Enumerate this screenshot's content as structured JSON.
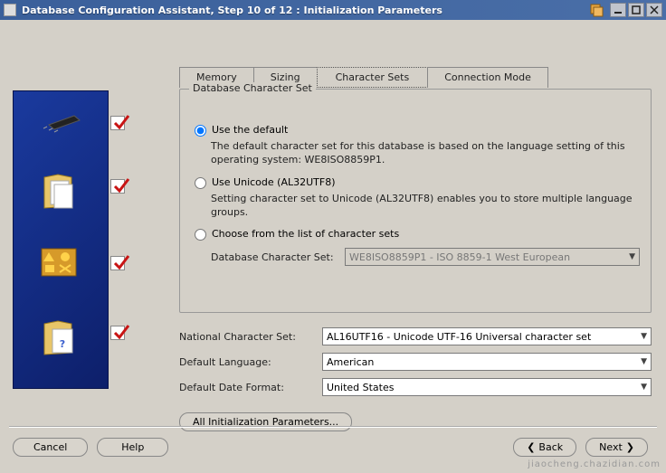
{
  "window": {
    "title": "Database Configuration Assistant, Step 10 of 12 : Initialization Parameters"
  },
  "tabs": {
    "memory": "Memory",
    "sizing": "Sizing",
    "charsets": "Character Sets",
    "connmode": "Connection Mode"
  },
  "group": {
    "title": "Database Character Set"
  },
  "radio": {
    "default_label": "Use the default",
    "default_desc": "The default character set for this database is based on the language setting of this operating system: WE8ISO8859P1.",
    "unicode_label": "Use Unicode (AL32UTF8)",
    "unicode_desc": "Setting character set to Unicode (AL32UTF8) enables you to store multiple language groups.",
    "choose_label": "Choose from the list of character sets",
    "choose_field_label": "Database Character Set:",
    "choose_value": "WE8ISO8859P1 - ISO 8859-1 West European"
  },
  "fields": {
    "national_label": "National Character Set:",
    "national_value": "AL16UTF16 - Unicode UTF-16 Universal character set",
    "lang_label": "Default Language:",
    "lang_value": "American",
    "date_label": "Default Date Format:",
    "date_value": "United States"
  },
  "buttons": {
    "all_params": "All Initialization Parameters...",
    "cancel": "Cancel",
    "help": "Help",
    "back": "Back",
    "next": "Next"
  },
  "watermark": "jiaocheng.chazidian.com"
}
